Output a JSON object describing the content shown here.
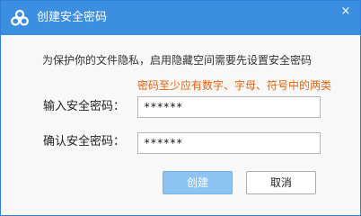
{
  "window": {
    "title": "创建安全密码",
    "close_glyph": "×",
    "app_icon": "cloud-loop-icon"
  },
  "content": {
    "description": "为保护你的文件隐私，启用隐藏空间需要先设置安全密码",
    "warning": "密码至少应有数字、字母、符号中的两类",
    "warning_color": "#e8620f"
  },
  "form": {
    "password_label": "输入安全密码：",
    "password_value": "******",
    "confirm_label": "确认安全密码：",
    "confirm_value": "******"
  },
  "buttons": {
    "create": "创建",
    "cancel": "取消"
  },
  "colors": {
    "titlebar": "#3c8fe0",
    "primary_button": "#8cc3f0"
  }
}
